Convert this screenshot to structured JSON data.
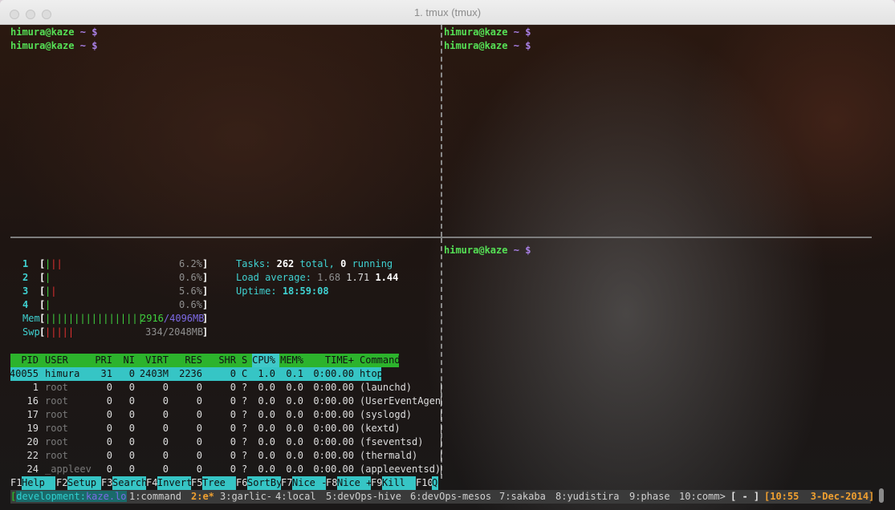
{
  "window": {
    "title": "1. tmux (tmux)"
  },
  "prompt": {
    "user_host": "himura@kaze",
    "path": "~",
    "symbol": "$"
  },
  "htop": {
    "cpus": [
      {
        "num": "1",
        "bar": "|||",
        "pct": "6.2%"
      },
      {
        "num": "2",
        "bar": "|",
        "pct": "0.6%"
      },
      {
        "num": "3",
        "bar": "||",
        "pct": "5.6%"
      },
      {
        "num": "4",
        "bar": "|",
        "pct": "0.6%"
      }
    ],
    "mem": {
      "label": "Mem",
      "bar": "|||||||||||||||||",
      "used": "2916",
      "total": "/4096MB"
    },
    "swp": {
      "label": "Swp",
      "bar": "|||||",
      "value": "334/2048MB"
    },
    "tasks": {
      "label": "Tasks:",
      "total": "262",
      "total_label": "total,",
      "running": "0",
      "running_label": "running"
    },
    "load": {
      "label": "Load average:",
      "l1": "1.68",
      "l5": "1.71",
      "l15": "1.44"
    },
    "uptime": {
      "label": "Uptime:",
      "value": "18:59:08"
    },
    "columns": {
      "pid": "PID",
      "user": "USER",
      "pri": "PRI",
      "ni": "NI",
      "virt": "VIRT",
      "res": "RES",
      "shr": "SHR",
      "s": "S",
      "cpu": "CPU%",
      "mem": "MEM%",
      "time": "TIME+",
      "command": "Command"
    },
    "processes": [
      {
        "pid": "40055",
        "user": "himura",
        "pri": "31",
        "ni": "0",
        "virt": "2403M",
        "res": "2236",
        "shr": "0",
        "s": "C",
        "cpu": "1.0",
        "mem": "0.1",
        "time": "0:00.00",
        "command": "htop"
      },
      {
        "pid": "1",
        "user": "root",
        "pri": "0",
        "ni": "0",
        "virt": "0",
        "res": "0",
        "shr": "0",
        "s": "?",
        "cpu": "0.0",
        "mem": "0.0",
        "time": "0:00.00",
        "command": "(launchd)"
      },
      {
        "pid": "16",
        "user": "root",
        "pri": "0",
        "ni": "0",
        "virt": "0",
        "res": "0",
        "shr": "0",
        "s": "?",
        "cpu": "0.0",
        "mem": "0.0",
        "time": "0:00.00",
        "command": "(UserEventAgen"
      },
      {
        "pid": "17",
        "user": "root",
        "pri": "0",
        "ni": "0",
        "virt": "0",
        "res": "0",
        "shr": "0",
        "s": "?",
        "cpu": "0.0",
        "mem": "0.0",
        "time": "0:00.00",
        "command": "(syslogd)"
      },
      {
        "pid": "19",
        "user": "root",
        "pri": "0",
        "ni": "0",
        "virt": "0",
        "res": "0",
        "shr": "0",
        "s": "?",
        "cpu": "0.0",
        "mem": "0.0",
        "time": "0:00.00",
        "command": "(kextd)"
      },
      {
        "pid": "20",
        "user": "root",
        "pri": "0",
        "ni": "0",
        "virt": "0",
        "res": "0",
        "shr": "0",
        "s": "?",
        "cpu": "0.0",
        "mem": "0.0",
        "time": "0:00.00",
        "command": "(fseventsd)"
      },
      {
        "pid": "22",
        "user": "root",
        "pri": "0",
        "ni": "0",
        "virt": "0",
        "res": "0",
        "shr": "0",
        "s": "?",
        "cpu": "0.0",
        "mem": "0.0",
        "time": "0:00.00",
        "command": "(thermald)"
      },
      {
        "pid": "24",
        "user": "_appleev",
        "pri": "0",
        "ni": "0",
        "virt": "0",
        "res": "0",
        "shr": "0",
        "s": "?",
        "cpu": "0.0",
        "mem": "0.0",
        "time": "0:00.00",
        "command": "(appleeventsd)"
      }
    ],
    "fkeys": [
      {
        "key": "F1",
        "label": "Help"
      },
      {
        "key": "F2",
        "label": "Setup"
      },
      {
        "key": "F3",
        "label": "Search"
      },
      {
        "key": "F4",
        "label": "Invert"
      },
      {
        "key": "F5",
        "label": "Tree"
      },
      {
        "key": "F6",
        "label": "SortBy"
      },
      {
        "key": "F7",
        "label": "Nice -"
      },
      {
        "key": "F8",
        "label": "Nice +"
      },
      {
        "key": "F9",
        "label": "Kill"
      },
      {
        "key": "F10",
        "label": "Q"
      }
    ]
  },
  "tmux": {
    "session_name": "development",
    "host": "kaze.lo",
    "windows": [
      {
        "label": "1:command"
      },
      {
        "label": "2:e*"
      },
      {
        "label": "3:garlic-"
      },
      {
        "label": "4:local"
      },
      {
        "label": "5:devOps-hive"
      },
      {
        "label": "6:devOps-mesos"
      },
      {
        "label": "7:sakaba"
      },
      {
        "label": "8:yudistira"
      },
      {
        "label": "9:phase"
      },
      {
        "label": "10:comm>"
      }
    ],
    "flags": "[ - ]",
    "clock": "[10:55  3-Dec-2014]"
  },
  "colors": {
    "prompt_green": "#55e055",
    "prompt_purple": "#a980e6",
    "htop_cyan": "#36c5c5",
    "htop_header_green": "#2cb32c",
    "tmux_status": "#3a3a3a",
    "tmux_active": "#f0a030"
  }
}
